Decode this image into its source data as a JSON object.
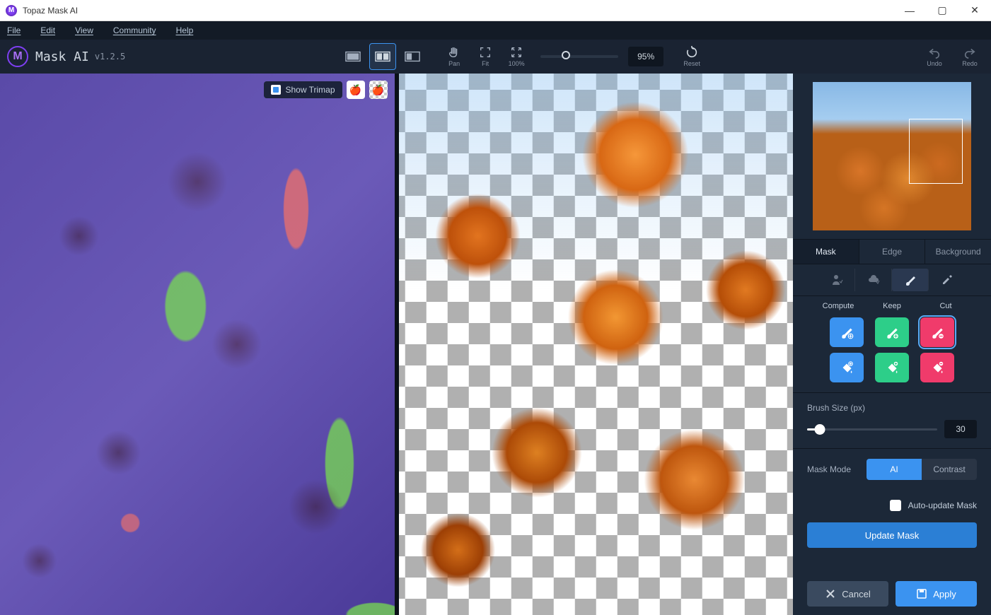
{
  "window": {
    "title": "Topaz Mask AI"
  },
  "menu": {
    "file": "File",
    "edit": "Edit",
    "view": "View",
    "community": "Community",
    "help": "Help"
  },
  "header": {
    "app": "Mask AI",
    "version": "v1.2.5",
    "pan": "Pan",
    "fit": "Fit",
    "hundred": "100%",
    "zoom": "95%",
    "reset": "Reset",
    "undo": "Undo",
    "redo": "Redo"
  },
  "trimap": {
    "label": "Show Trimap"
  },
  "tabs": {
    "mask": "Mask",
    "edge": "Edge",
    "background": "Background"
  },
  "cols": {
    "compute": "Compute",
    "keep": "Keep",
    "cut": "Cut"
  },
  "brush": {
    "label": "Brush Size (px)",
    "value": "30"
  },
  "mode": {
    "label": "Mask Mode",
    "ai": "AI",
    "contrast": "Contrast"
  },
  "auto": {
    "label": "Auto-update Mask"
  },
  "update": {
    "label": "Update Mask"
  },
  "footer": {
    "cancel": "Cancel",
    "apply": "Apply"
  }
}
